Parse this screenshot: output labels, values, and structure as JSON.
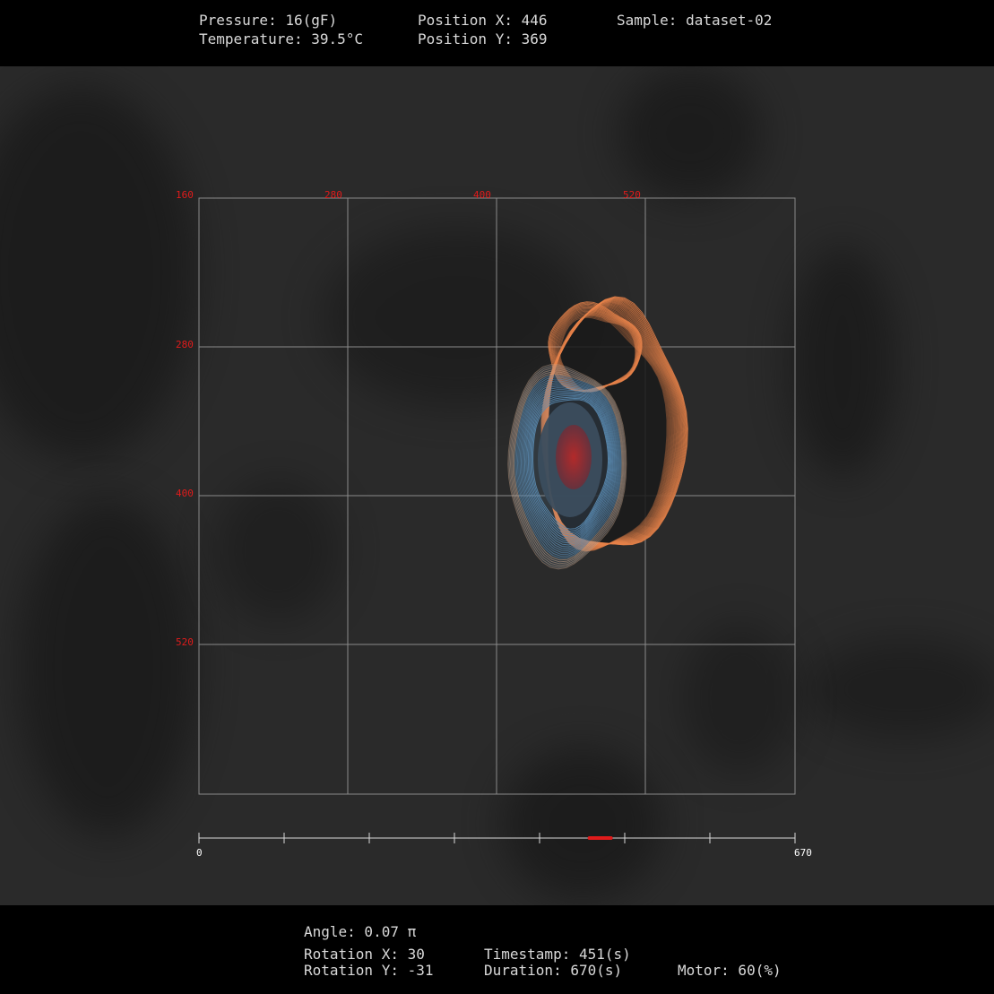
{
  "header": {
    "pressure": "Pressure: 16(gF)",
    "temperature": "Temperature: 39.5°C",
    "position_x": "Position X: 446",
    "position_y": "Position Y: 369",
    "sample": "Sample: dataset-02"
  },
  "grid": {
    "x_labels": [
      "160",
      "280",
      "400",
      "520"
    ],
    "y_labels": [
      "280",
      "400",
      "520"
    ]
  },
  "timeline": {
    "start_label": "0",
    "end_label": "670",
    "max": 670,
    "current": 451
  },
  "footer": {
    "angle": "Angle: 0.07 π",
    "rotation_x": "Rotation X: 30",
    "rotation_y": "Rotation Y: -31",
    "timestamp": "Timestamp: 451(s)",
    "duration": "Duration: 670(s)",
    "motor": "Motor: 60(%)"
  },
  "colors": {
    "accent": "#e01b1b",
    "shape_orange": "#e8834a",
    "shape_blue": "#5b8db5",
    "grid_line": "#8a8a8a"
  },
  "compass": {
    "angle_pi": 0.07
  },
  "icons": {
    "compass": "compass-dial-icon",
    "scan_shape": "3d-scan-blob"
  }
}
